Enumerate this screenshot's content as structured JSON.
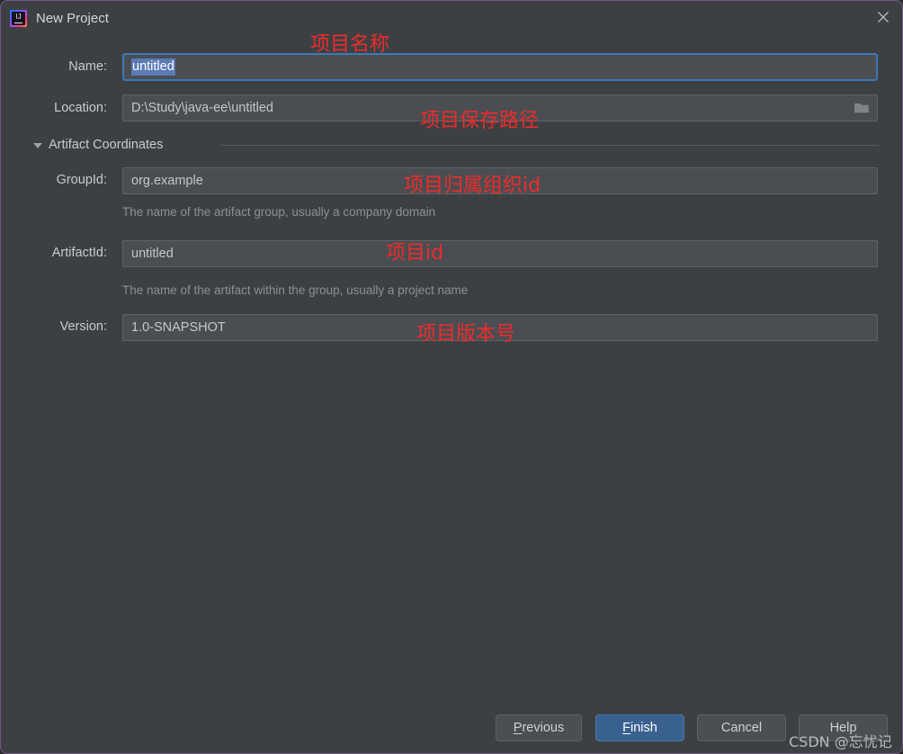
{
  "window": {
    "title": "New Project",
    "app_icon": "intellij-idea-icon",
    "close_icon": "close-icon",
    "border_color": "#6f5b82",
    "background_color": "#3c4043"
  },
  "form": {
    "name": {
      "label": "Name:",
      "value": "untitled",
      "selected": true,
      "focused": true
    },
    "location": {
      "label": "Location:",
      "value": "D:\\Study\\java-ee\\untitled",
      "browse_icon": "folder-icon"
    },
    "section": {
      "label": "Artifact Coordinates",
      "expanded": true,
      "toggle_icon": "triangle-down-icon"
    },
    "group_id": {
      "label": "GroupId:",
      "value": "org.example",
      "hint": "The name of the artifact group, usually a company domain"
    },
    "artifact_id": {
      "label": "ArtifactId:",
      "value": "untitled",
      "hint": "The name of the artifact within the group, usually a project name"
    },
    "version": {
      "label": "Version:",
      "value": "1.0-SNAPSHOT"
    }
  },
  "annotations": {
    "color": "#ee2b2b",
    "items": [
      {
        "text": "项目名称",
        "meaning": "project-name"
      },
      {
        "text": "项目保存路径",
        "meaning": "project-save-path"
      },
      {
        "text": "项目归属组织id",
        "meaning": "project-group-id"
      },
      {
        "text": "项目id",
        "meaning": "project-artifact-id"
      },
      {
        "text": "项目版本号",
        "meaning": "project-version"
      }
    ]
  },
  "buttons": {
    "previous": {
      "label": "Previous",
      "mnemonic": "P"
    },
    "finish": {
      "label": "Finish",
      "mnemonic": "F",
      "primary": true,
      "color": "#39618f"
    },
    "cancel": {
      "label": "Cancel"
    },
    "help": {
      "label": "Help"
    }
  },
  "watermark": {
    "text": "CSDN @忘忧记"
  }
}
